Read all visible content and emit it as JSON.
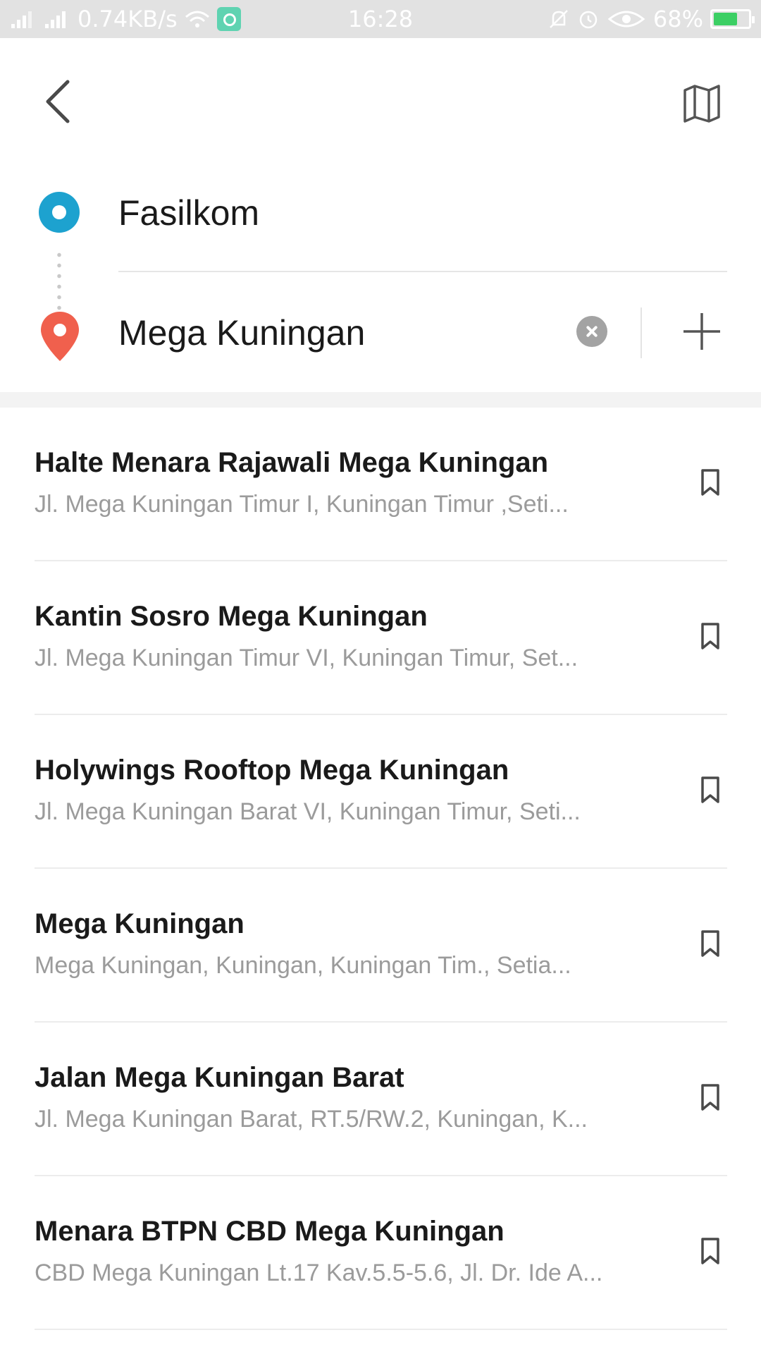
{
  "status_bar": {
    "network_speed": "0.74KB/s",
    "time": "16:28",
    "battery": "68%",
    "battery_level": 0.68,
    "icons": [
      "signal-icon",
      "signal-icon",
      "wifi-icon",
      "app-icon",
      "mute-bell-icon",
      "alarm-icon",
      "eye-icon",
      "battery-icon"
    ]
  },
  "header": {
    "back_icon": "chevron-left-icon",
    "map_icon": "map-icon"
  },
  "route": {
    "origin": "Fasilkom",
    "destination": "Mega Kuningan",
    "origin_color": "#1da2cf",
    "destination_color": "#f0604d"
  },
  "results": [
    {
      "title": "Halte Menara Rajawali Mega Kuningan",
      "address": "Jl. Mega Kuningan Timur I, Kuningan Timur ,Seti..."
    },
    {
      "title": "Kantin Sosro Mega Kuningan",
      "address": "Jl. Mega Kuningan Timur VI, Kuningan Timur, Set..."
    },
    {
      "title": "Holywings Rooftop Mega Kuningan",
      "address": "Jl. Mega Kuningan Barat VI, Kuningan Timur, Seti..."
    },
    {
      "title": "Mega Kuningan",
      "address": "Mega Kuningan, Kuningan, Kuningan Tim., Setia..."
    },
    {
      "title": "Jalan Mega Kuningan Barat",
      "address": "Jl. Mega Kuningan Barat, RT.5/RW.2, Kuningan, K..."
    },
    {
      "title": "Menara BTPN CBD Mega Kuningan",
      "address": "CBD Mega Kuningan Lt.17 Kav.5.5-5.6, Jl. Dr. Ide A..."
    }
  ]
}
